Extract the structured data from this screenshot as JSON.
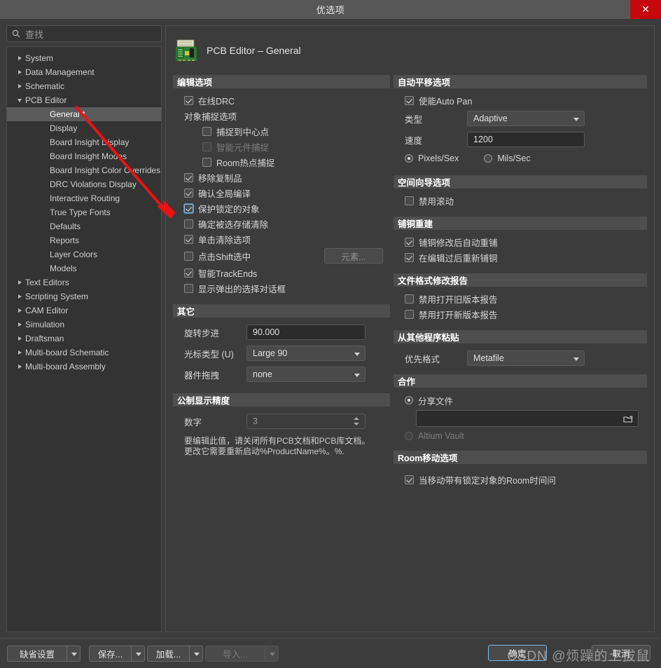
{
  "window": {
    "title": "优选项",
    "close_label": "✕"
  },
  "sidebar": {
    "search": {
      "placeholder": "查找",
      "icon": "search-icon"
    },
    "items": [
      {
        "label": "System",
        "level": 0,
        "expander": "collapsed",
        "selected": false
      },
      {
        "label": "Data Management",
        "level": 0,
        "expander": "collapsed",
        "selected": false
      },
      {
        "label": "Schematic",
        "level": 0,
        "expander": "collapsed",
        "selected": false
      },
      {
        "label": "PCB Editor",
        "level": 0,
        "expander": "expanded",
        "selected": false
      },
      {
        "label": "General *",
        "level": 1,
        "expander": "none",
        "selected": true
      },
      {
        "label": "Display",
        "level": 1,
        "expander": "none",
        "selected": false
      },
      {
        "label": "Board Insight Display",
        "level": 1,
        "expander": "none",
        "selected": false
      },
      {
        "label": "Board Insight Modes",
        "level": 1,
        "expander": "none",
        "selected": false
      },
      {
        "label": "Board Insight Color Overrides",
        "level": 1,
        "expander": "none",
        "selected": false
      },
      {
        "label": "DRC Violations Display",
        "level": 1,
        "expander": "none",
        "selected": false
      },
      {
        "label": "Interactive Routing",
        "level": 1,
        "expander": "none",
        "selected": false
      },
      {
        "label": "True Type Fonts",
        "level": 1,
        "expander": "none",
        "selected": false
      },
      {
        "label": "Defaults",
        "level": 1,
        "expander": "none",
        "selected": false
      },
      {
        "label": "Reports",
        "level": 1,
        "expander": "none",
        "selected": false
      },
      {
        "label": "Layer Colors",
        "level": 1,
        "expander": "none",
        "selected": false
      },
      {
        "label": "Models",
        "level": 1,
        "expander": "none",
        "selected": false
      },
      {
        "label": "Text Editors",
        "level": 0,
        "expander": "collapsed",
        "selected": false
      },
      {
        "label": "Scripting System",
        "level": 0,
        "expander": "collapsed",
        "selected": false
      },
      {
        "label": "CAM Editor",
        "level": 0,
        "expander": "collapsed",
        "selected": false
      },
      {
        "label": "Simulation",
        "level": 0,
        "expander": "collapsed",
        "selected": false
      },
      {
        "label": "Draftsman",
        "level": 0,
        "expander": "collapsed",
        "selected": false
      },
      {
        "label": "Multi-board Schematic",
        "level": 0,
        "expander": "collapsed",
        "selected": false
      },
      {
        "label": "Multi-board Assembly",
        "level": 0,
        "expander": "collapsed",
        "selected": false
      }
    ]
  },
  "page": {
    "title": "PCB Editor – General",
    "icon": "pcb-board-icon"
  },
  "editing_options": {
    "header": "编辑选项",
    "online_drc": {
      "label": "在线DRC",
      "checked": true
    },
    "snap_group_label": "对象捕捉选项",
    "snap_to_center": {
      "label": "捕捉到中心点",
      "checked": false,
      "disabled": false
    },
    "smart_component": {
      "label": "智能元件捕捉",
      "checked": false,
      "disabled": true
    },
    "room_hotspot": {
      "label": "Room热点捕捉",
      "checked": false,
      "disabled": false
    },
    "remove_duplicates": {
      "label": "移除复制品",
      "checked": true,
      "disabled": false
    },
    "confirm_global": {
      "label": "确认全局编译",
      "checked": true,
      "disabled": false
    },
    "protect_locked": {
      "label": "保护锁定的对象",
      "checked": true,
      "disabled": false,
      "highlighted": true
    },
    "confirm_clear": {
      "label": "确定被选存储清除",
      "checked": false,
      "disabled": false
    },
    "click_clears": {
      "label": "单击清除选项",
      "checked": true,
      "disabled": false
    },
    "shift_click": {
      "label": "点击Shift选中",
      "checked": false,
      "disabled": false
    },
    "shift_click_button": "元素...",
    "smart_trackends": {
      "label": "智能TrackEnds",
      "checked": true,
      "disabled": false
    },
    "show_popup": {
      "label": "显示弹出的选择对话框",
      "checked": false,
      "disabled": false
    }
  },
  "other": {
    "header": "其它",
    "rotation_step": {
      "label": "旋转步进",
      "value": "90.000"
    },
    "cursor_type": {
      "label": "光标类型 (U)",
      "value": "Large 90"
    },
    "comp_drag": {
      "label": "器件拖拽",
      "value": "none"
    }
  },
  "metric_precision": {
    "header": "公制显示精度",
    "digits": {
      "label": "数字",
      "value": "3"
    },
    "note_line1": "要编辑此值，请关闭所有PCB文档和PCB库文档。",
    "note_line2": "更改它需要重新启动%ProductName%。%."
  },
  "auto_pan": {
    "header": "自动平移选项",
    "enable": {
      "label": "使能Auto Pan",
      "checked": true
    },
    "style": {
      "label": "类型",
      "value": "Adaptive"
    },
    "speed": {
      "label": "速度",
      "value": "1200"
    },
    "unit_pixels": {
      "label": "Pixels/Sex",
      "selected": true
    },
    "unit_mils": {
      "label": "Mils/Sec",
      "selected": false
    }
  },
  "space_navigator": {
    "header": "空间向导选项",
    "disable_rolling": {
      "label": "禁用滚动",
      "checked": false
    }
  },
  "polygon_rebuild": {
    "header": "铺铜重建",
    "repour_after_edit": {
      "label": "铺铜修改后自动重铺",
      "checked": true
    },
    "repour_after_edits": {
      "label": "在编辑过后重新铺铜",
      "checked": true
    }
  },
  "file_format_report": {
    "header": "文件格式修改报告",
    "disable_old": {
      "label": "禁用打开旧版本报告",
      "checked": false
    },
    "disable_new": {
      "label": "禁用打开新版本报告",
      "checked": false
    }
  },
  "paste_from_other": {
    "header": "从其他程序粘贴",
    "priority": {
      "label": "优先格式",
      "value": "Metafile"
    }
  },
  "collaboration": {
    "header": "合作",
    "shared_file": {
      "label": "分享文件",
      "selected": true
    },
    "path_value": "",
    "browse_icon": "folder-open-icon",
    "altium_vault": {
      "label": "Altium Vault",
      "selected": false,
      "disabled": true
    }
  },
  "room_move": {
    "header": "Room移动选项",
    "ask_on_move": {
      "label": "当移动带有锁定对象的Room时间问",
      "checked": true
    }
  },
  "footer": {
    "defaults": {
      "label": "缺省设置",
      "disabled": false
    },
    "save": {
      "label": "保存...",
      "disabled": false
    },
    "load": {
      "label": "加载...",
      "disabled": false
    },
    "import": {
      "label": "导入...",
      "disabled": true
    },
    "ok": {
      "label": "确定"
    },
    "cancel": {
      "label": "取消"
    }
  },
  "watermark": {
    "text": "CSDN @烦躁的土拔鼠"
  },
  "annotation": {
    "type": "red-arrow",
    "color": "#ee1111"
  }
}
